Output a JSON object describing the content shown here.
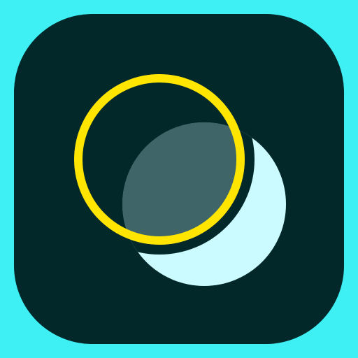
{
  "icon": {
    "name": "eclipse-app-icon",
    "colors": {
      "background": "#3ef0f4",
      "tile": "#02282a",
      "moon": "#ccfbff",
      "overlap": "#406569",
      "ring": "#ffe500"
    }
  }
}
